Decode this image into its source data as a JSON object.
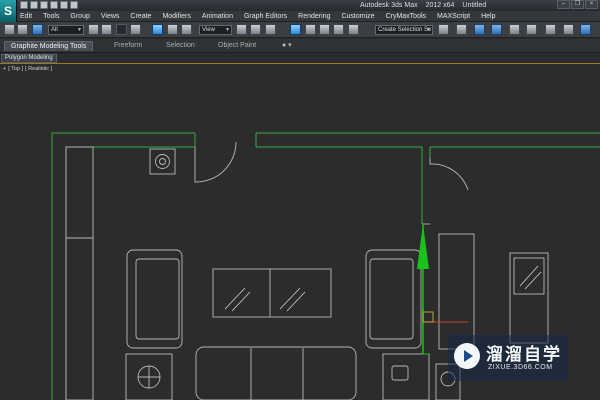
{
  "window": {
    "app_title": "Autodesk 3ds Max",
    "version": "2012 x64",
    "file_name": "Untitled",
    "logo_glyph": "S",
    "window_buttons": [
      "–",
      "❐",
      "×"
    ]
  },
  "menu": {
    "items": [
      "Edit",
      "Tools",
      "Group",
      "Views",
      "Create",
      "Modifiers",
      "Animation",
      "Graph Editors",
      "Rendering",
      "Customize",
      "CryMaxTools",
      "MAXScript",
      "Help"
    ]
  },
  "toolbar": {
    "selection_filter": "All",
    "reference_coord": "View",
    "named_selection_placeholder": "Create Selection Se"
  },
  "ribbon": {
    "tabs": [
      "Graphite Modeling Tools",
      "Freeform",
      "Selection",
      "Object Paint"
    ],
    "active_tab": "Graphite Modeling Tools",
    "extra_icons": "● ▾"
  },
  "panel": {
    "label": "Polygon Modeling"
  },
  "viewport": {
    "label_plus": "+",
    "label_view": "[ Top ]",
    "label_shading": "[ Realistic ]"
  },
  "watermark": {
    "title": "溜溜自学",
    "url": "ZIXUE.3D66.COM"
  },
  "colors": {
    "wall_green": "#3da843",
    "furniture_gray": "#b9b9b9",
    "gizmo_green": "#18c21a",
    "gizmo_red": "#d43a3a",
    "accent_orange": "#9a7a2a"
  },
  "icons": [
    "app-logo-icon",
    "move-icon",
    "rotate-icon",
    "scale-icon",
    "render-icon",
    "snap-icon"
  ]
}
